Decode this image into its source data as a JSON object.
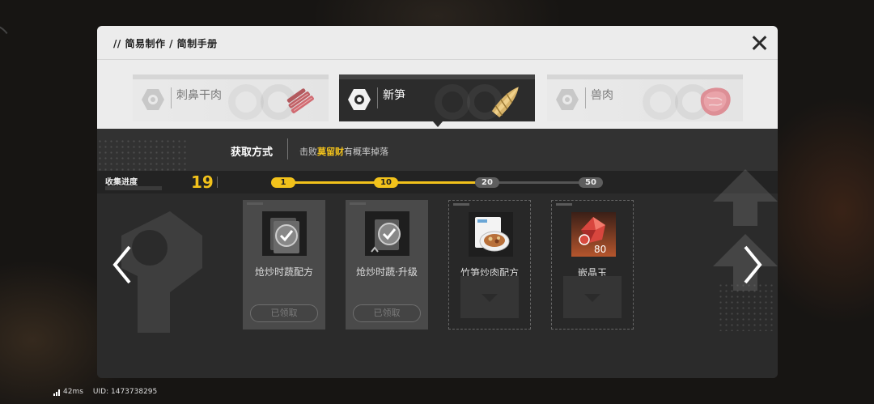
{
  "breadcrumb": "// 简易制作 / 简制手册",
  "items": [
    {
      "name": "刺鼻干肉",
      "state": "inactive"
    },
    {
      "name": "新笋",
      "state": "active"
    },
    {
      "name": "兽肉",
      "state": "inactive"
    }
  ],
  "acquisition": {
    "label": "获取方式",
    "prefix": "击败",
    "highlight": "莫留财",
    "suffix": "有概率掉落"
  },
  "progress": {
    "label": "收集进度",
    "count": "19",
    "milestones": [
      {
        "value": "1",
        "reached": true
      },
      {
        "value": "10",
        "reached": true
      },
      {
        "value": "20",
        "reached": false
      },
      {
        "value": "50",
        "reached": false
      }
    ]
  },
  "rewards": [
    {
      "label": "炝炒时蔬配方",
      "status": "claimed",
      "button": "已领取",
      "icon": "recipe-card-icon"
    },
    {
      "label": "炝炒时蔬·升级",
      "status": "claimed",
      "button": "已领取",
      "icon": "recipe-upgrade-icon"
    },
    {
      "label": "竹笋炒肉配方",
      "status": "locked",
      "icon": "dish-recipe-icon"
    },
    {
      "label": "嵌晶玉",
      "status": "locked",
      "quantity": "80",
      "icon": "crystal-icon"
    }
  ],
  "status_bar": {
    "ping": "42ms",
    "uid": "UID: 1473738295"
  },
  "colors": {
    "accent": "#f2c21b",
    "panel_dark": "#2b2b2b",
    "panel_light": "#ececec"
  }
}
